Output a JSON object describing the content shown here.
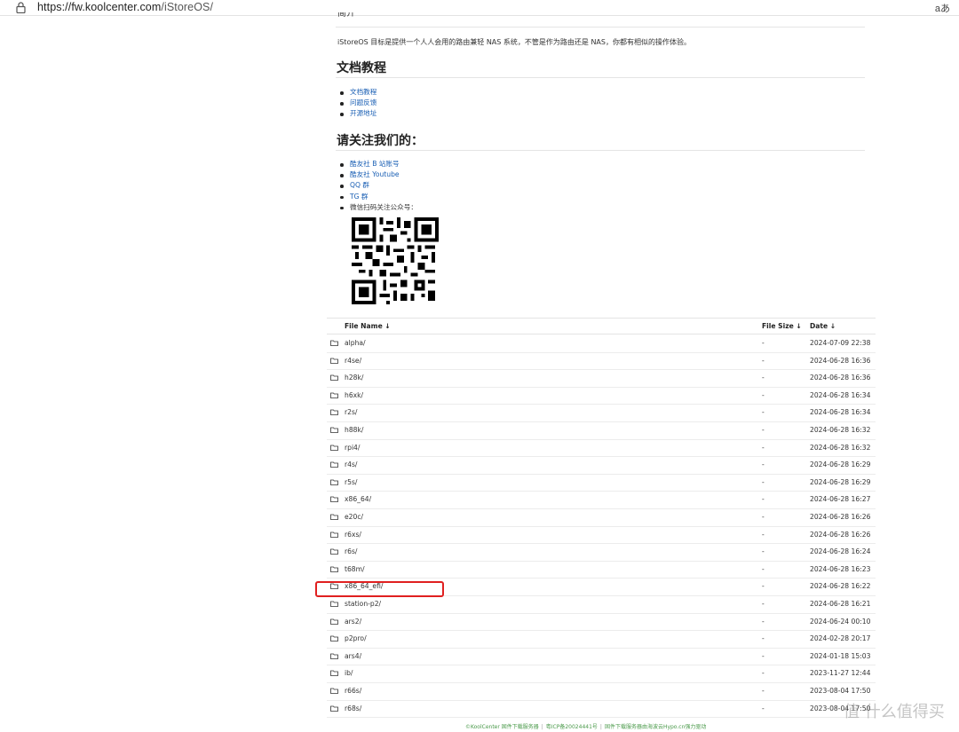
{
  "browser": {
    "url_host": "https://fw.koolcenter.com",
    "url_path": "/iStoreOS/",
    "reader_label": "aあ"
  },
  "page": {
    "cut_heading": "简介",
    "description": "iStoreOS 目标是提供一个人人会用的路由兼轻 NAS 系统，不管是作为路由还是 NAS，你都有相似的操作体验。",
    "docs_heading": "文档教程",
    "docs_links": [
      "文档教程",
      "问题反馈",
      "开源地址"
    ],
    "follow_heading": "请关注我们的：",
    "follow_links": [
      "酷友社 B 站账号",
      "酷友社 Youtube",
      "QQ 群",
      "TG 群"
    ],
    "wechat_label": "微信扫码关注公众号："
  },
  "table": {
    "headers": {
      "name": "File Name  ↓",
      "size": "File Size  ↓",
      "date": "Date  ↓"
    },
    "rows": [
      {
        "name": "alpha/",
        "size": "-",
        "date": "2024-07-09 22:38"
      },
      {
        "name": "r4se/",
        "size": "-",
        "date": "2024-06-28 16:36"
      },
      {
        "name": "h28k/",
        "size": "-",
        "date": "2024-06-28 16:36"
      },
      {
        "name": "h6xk/",
        "size": "-",
        "date": "2024-06-28 16:34"
      },
      {
        "name": "r2s/",
        "size": "-",
        "date": "2024-06-28 16:34"
      },
      {
        "name": "h88k/",
        "size": "-",
        "date": "2024-06-28 16:32"
      },
      {
        "name": "rpi4/",
        "size": "-",
        "date": "2024-06-28 16:32"
      },
      {
        "name": "r4s/",
        "size": "-",
        "date": "2024-06-28 16:29"
      },
      {
        "name": "r5s/",
        "size": "-",
        "date": "2024-06-28 16:29"
      },
      {
        "name": "x86_64/",
        "size": "-",
        "date": "2024-06-28 16:27"
      },
      {
        "name": "e20c/",
        "size": "-",
        "date": "2024-06-28 16:26"
      },
      {
        "name": "r6xs/",
        "size": "-",
        "date": "2024-06-28 16:26"
      },
      {
        "name": "r6s/",
        "size": "-",
        "date": "2024-06-28 16:24"
      },
      {
        "name": "t68m/",
        "size": "-",
        "date": "2024-06-28 16:23"
      },
      {
        "name": "x86_64_efi/",
        "size": "-",
        "date": "2024-06-28 16:22"
      },
      {
        "name": "station-p2/",
        "size": "-",
        "date": "2024-06-28 16:21"
      },
      {
        "name": "ars2/",
        "size": "-",
        "date": "2024-06-24 00:10"
      },
      {
        "name": "p2pro/",
        "size": "-",
        "date": "2024-02-28 20:17"
      },
      {
        "name": "ars4/",
        "size": "-",
        "date": "2024-01-18 15:03"
      },
      {
        "name": "ib/",
        "size": "-",
        "date": "2023-11-27 12:44"
      },
      {
        "name": "r66s/",
        "size": "-",
        "date": "2023-08-04 17:50"
      },
      {
        "name": "r68s/",
        "size": "-",
        "date": "2023-08-04 17:50"
      }
    ]
  },
  "footer": {
    "copyright": "©KoolCenter 固件下载服务器",
    "icp": "粤ICP备20024441号",
    "sponsor": "固件下载服务器由海波云Hypo.cn强力驱动"
  },
  "watermark": "值 什么值得买",
  "colors": {
    "link": "#1a5fb4",
    "highlight": "#e02020",
    "footer": "#4a9a4a"
  }
}
